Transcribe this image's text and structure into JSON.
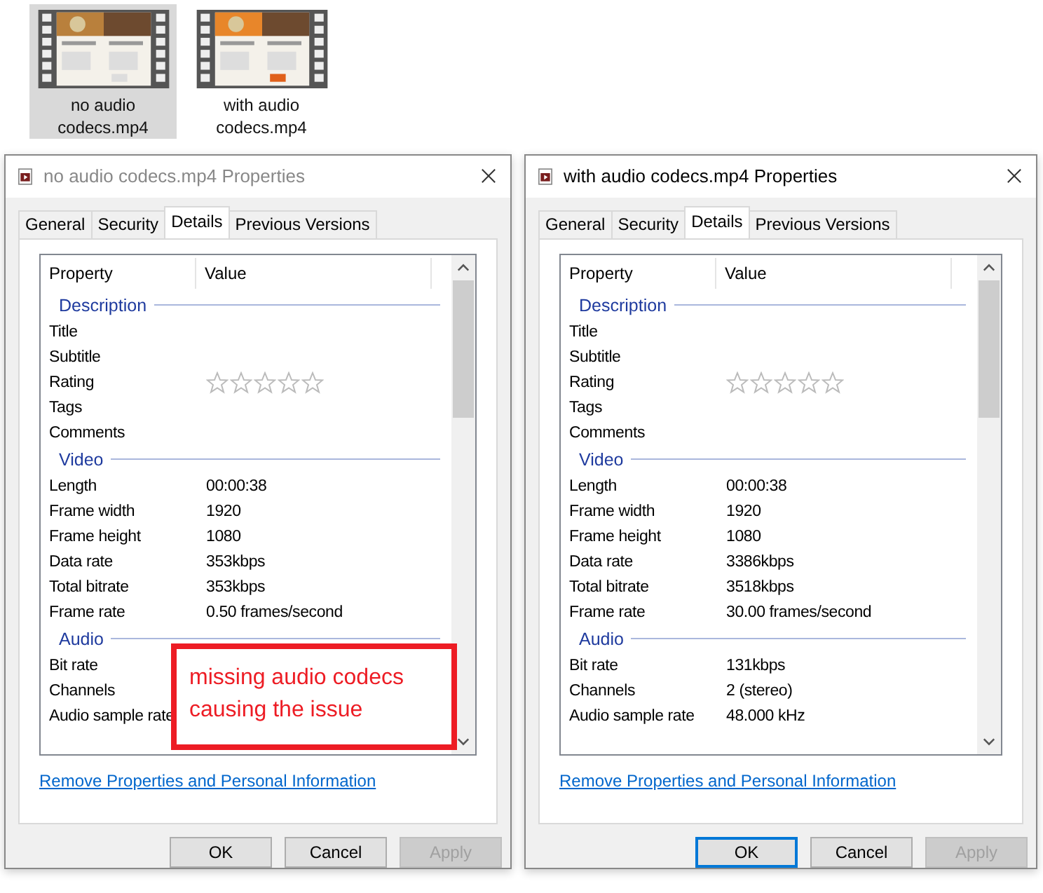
{
  "files": [
    {
      "name": "no audio codecs.mp4",
      "selected": true
    },
    {
      "name": "with audio codecs.mp4",
      "selected": false
    }
  ],
  "dialogs": [
    {
      "title": "no audio codecs.mp4 Properties",
      "active": false,
      "tabs": [
        {
          "label": "General",
          "selected": false
        },
        {
          "label": "Security",
          "selected": false
        },
        {
          "label": "Details",
          "selected": true
        },
        {
          "label": "Previous Versions",
          "selected": false
        }
      ],
      "columns": [
        "Property",
        "Value"
      ],
      "sections": [
        {
          "heading": "Description",
          "rows": [
            {
              "property": "Title"
            },
            {
              "property": "Subtitle"
            },
            {
              "property": "Rating",
              "kind": "rating",
              "stars": 0
            },
            {
              "property": "Tags"
            },
            {
              "property": "Comments"
            }
          ]
        },
        {
          "heading": "Video",
          "rows": [
            {
              "property": "Length",
              "value": "00:00:38"
            },
            {
              "property": "Frame width",
              "value": "1920"
            },
            {
              "property": "Frame height",
              "value": "1080"
            },
            {
              "property": "Data rate",
              "value": "353kbps"
            },
            {
              "property": "Total bitrate",
              "value": "353kbps"
            },
            {
              "property": "Frame rate",
              "value": "0.50 frames/second"
            }
          ]
        },
        {
          "heading": "Audio",
          "rows": [
            {
              "property": "Bit rate"
            },
            {
              "property": "Channels"
            },
            {
              "property": "Audio sample rate"
            }
          ]
        }
      ],
      "link": "Remove Properties and Personal Information",
      "buttons": [
        {
          "label": "OK",
          "disabled": false,
          "focused": false
        },
        {
          "label": "Cancel",
          "disabled": false,
          "focused": false
        },
        {
          "label": "Apply",
          "disabled": true,
          "focused": false
        }
      ],
      "annotation": "missing audio codecs causing the issue"
    },
    {
      "title": "with audio codecs.mp4 Properties",
      "active": true,
      "tabs": [
        {
          "label": "General",
          "selected": false
        },
        {
          "label": "Security",
          "selected": false
        },
        {
          "label": "Details",
          "selected": true
        },
        {
          "label": "Previous Versions",
          "selected": false
        }
      ],
      "columns": [
        "Property",
        "Value"
      ],
      "sections": [
        {
          "heading": "Description",
          "rows": [
            {
              "property": "Title"
            },
            {
              "property": "Subtitle"
            },
            {
              "property": "Rating",
              "kind": "rating",
              "stars": 0
            },
            {
              "property": "Tags"
            },
            {
              "property": "Comments"
            }
          ]
        },
        {
          "heading": "Video",
          "rows": [
            {
              "property": "Length",
              "value": "00:00:38"
            },
            {
              "property": "Frame width",
              "value": "1920"
            },
            {
              "property": "Frame height",
              "value": "1080"
            },
            {
              "property": "Data rate",
              "value": "3386kbps"
            },
            {
              "property": "Total bitrate",
              "value": "3518kbps"
            },
            {
              "property": "Frame rate",
              "value": "30.00 frames/second"
            }
          ]
        },
        {
          "heading": "Audio",
          "rows": [
            {
              "property": "Bit rate",
              "value": "131kbps"
            },
            {
              "property": "Channels",
              "value": "2 (stereo)"
            },
            {
              "property": "Audio sample rate",
              "value": "48.000 kHz"
            }
          ]
        }
      ],
      "link": "Remove Properties and Personal Information",
      "buttons": [
        {
          "label": "OK",
          "disabled": false,
          "focused": true
        },
        {
          "label": "Cancel",
          "disabled": false,
          "focused": false
        },
        {
          "label": "Apply",
          "disabled": true,
          "focused": false
        }
      ]
    }
  ]
}
